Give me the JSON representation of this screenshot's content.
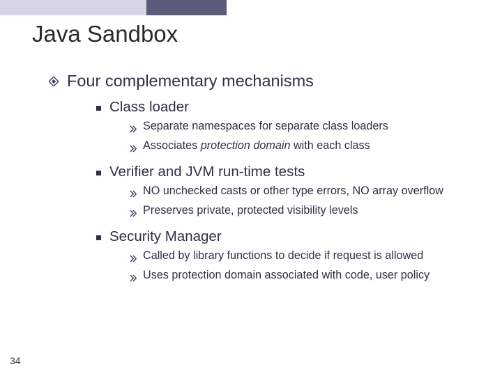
{
  "title": "Java Sandbox",
  "heading": "Four complementary mechanisms",
  "items": [
    {
      "label": "Class loader",
      "subs": [
        {
          "pre": "Separate namespaces for separate class loaders",
          "italic": "",
          "post": ""
        },
        {
          "pre": "Associates ",
          "italic": "protection domain",
          "post": " with each class"
        }
      ]
    },
    {
      "label": "Verifier and JVM run-time tests",
      "subs": [
        {
          "pre": "NO unchecked casts or other type errors, NO array overflow",
          "italic": "",
          "post": ""
        },
        {
          "pre": "Preserves private, protected visibility levels",
          "italic": "",
          "post": ""
        }
      ]
    },
    {
      "label": "Security Manager",
      "subs": [
        {
          "pre": "Called by library functions to decide if request is allowed",
          "italic": "",
          "post": ""
        },
        {
          "pre": "Uses protection domain associated with code, user policy",
          "italic": "",
          "post": ""
        }
      ]
    }
  ],
  "page": "34"
}
